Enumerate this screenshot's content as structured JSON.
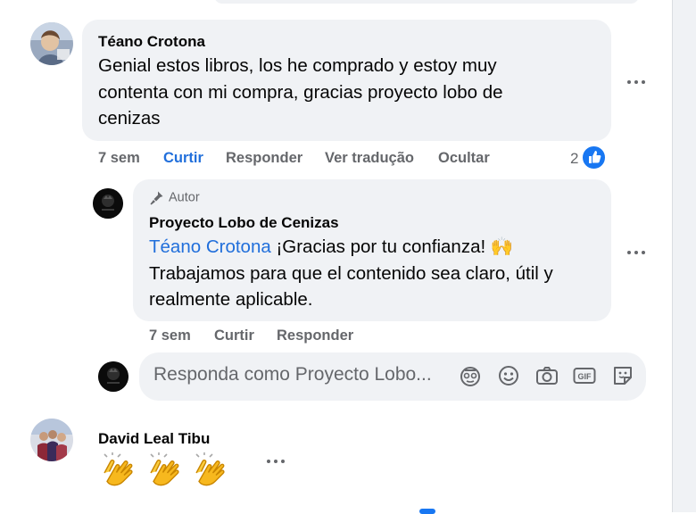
{
  "comments": [
    {
      "author": "Téano Crotona",
      "text_lines": [
        "Genial estos libros, los he comprado y estoy muy",
        "contenta con mi compra, gracias proyecto lobo de",
        "cenizas"
      ],
      "actions": {
        "time": "7 sem",
        "like": "Curtir",
        "reply": "Responder",
        "translate": "Ver tradução",
        "hide": "Ocultar"
      },
      "reaction_count": "2",
      "reply": {
        "badge": "Autor",
        "author": "Proyecto Lobo de Cenizas",
        "mention": "Téano Crotona",
        "text_line1_rest": " ¡Gracias por tu confianza! 🙌",
        "text_lines": [
          "Trabajamos para que el contenido sea claro, útil y",
          "realmente aplicable."
        ],
        "actions": {
          "time": "7 sem",
          "like": "Curtir",
          "reply": "Responder"
        }
      }
    },
    {
      "author": "David Leal Tibu",
      "emoji_content": "👏👏👏"
    }
  ],
  "reply_box": {
    "placeholder": "Responda como Proyecto Lobo..."
  },
  "icons": [
    "avatar-icon",
    "emoji-icon",
    "camera-icon",
    "gif-icon",
    "sticker-icon",
    "more-icon",
    "like-icon",
    "microphone-icon"
  ],
  "colors": {
    "link": "#216fdb",
    "bubble": "#f0f2f5",
    "muted": "#65676b",
    "like_badge": "#1877f2"
  }
}
